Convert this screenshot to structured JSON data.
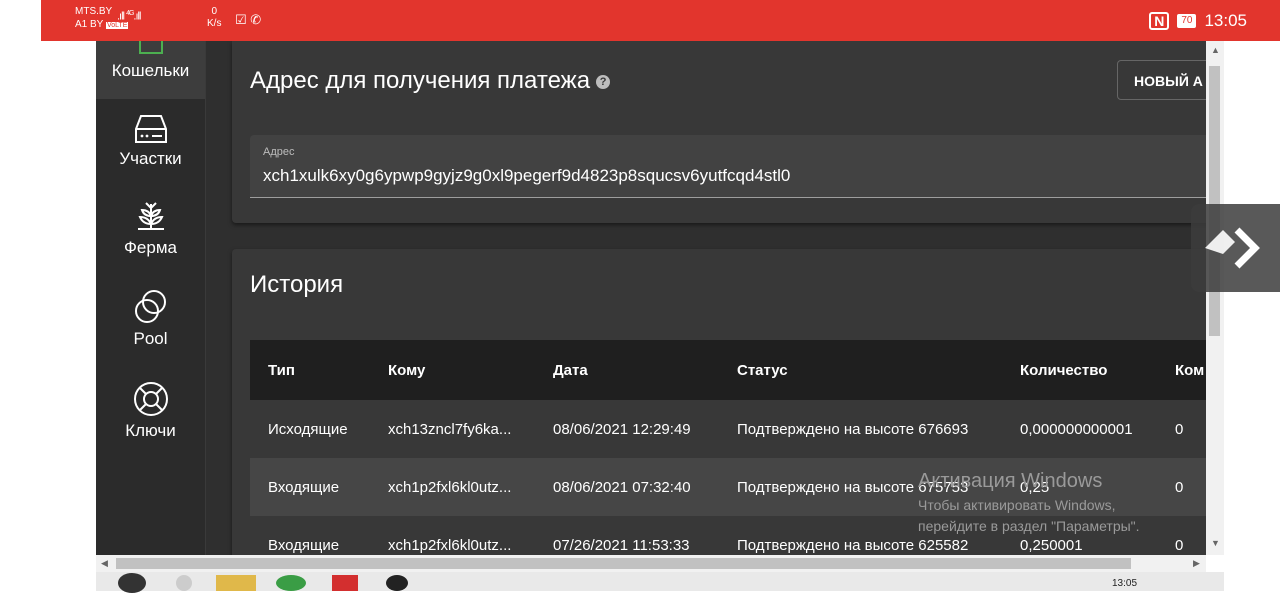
{
  "status_bar": {
    "operator1": "MTS.BY",
    "operator2": "A1 BY",
    "volte": "VoLTE",
    "net_type": "4G",
    "speed_value": "0",
    "speed_unit": "K/s",
    "battery": "70",
    "time": "13:05"
  },
  "sidebar": {
    "items": [
      {
        "label": "Кошельки",
        "icon": "wallet-icon",
        "active": true
      },
      {
        "label": "Участки",
        "icon": "drive-icon"
      },
      {
        "label": "Ферма",
        "icon": "sprout-icon"
      },
      {
        "label": "Pool",
        "icon": "pool-icon"
      },
      {
        "label": "Ключи",
        "icon": "lifebuoy-icon"
      }
    ]
  },
  "receive": {
    "title": "Адрес для получения платежа",
    "help": "?",
    "new_button": "НОВЫЙ А",
    "field_label": "Адрес",
    "address": "xch1xulk6xy0g6ypwp9gyjz9g0xl9pegerf9d4823p8squcsv6yutfcqd4stl0"
  },
  "history": {
    "title": "История",
    "columns": [
      "Тип",
      "Кому",
      "Дата",
      "Статус",
      "Количество",
      "Ком"
    ],
    "rows": [
      [
        "Исходящие",
        "xch13zncl7fy6ka...",
        "08/06/2021 12:29:49",
        "Подтверждено на высоте 676693",
        "0,000000000001",
        "0"
      ],
      [
        "Входящие",
        "xch1p2fxl6kl0utz...",
        "08/06/2021 07:32:40",
        "Подтверждено на высоте 675753",
        "0,25",
        "0"
      ],
      [
        "Входящие",
        "xch1p2fxl6kl0utz...",
        "07/26/2021 11:53:33",
        "Подтверждено на высоте 625582",
        "0,250001",
        "0"
      ]
    ]
  },
  "watermark": {
    "line1": "Активация Windows",
    "line2": "Чтобы активировать Windows,",
    "line3": "перейдите в раздел \"Параметры\"."
  },
  "taskbar": {
    "clock": "13:05"
  },
  "colors": {
    "status_bar": "#e2352d",
    "app_bg": "#2b2b2b",
    "card_bg": "#383838",
    "table_header": "#1f1f1f"
  }
}
